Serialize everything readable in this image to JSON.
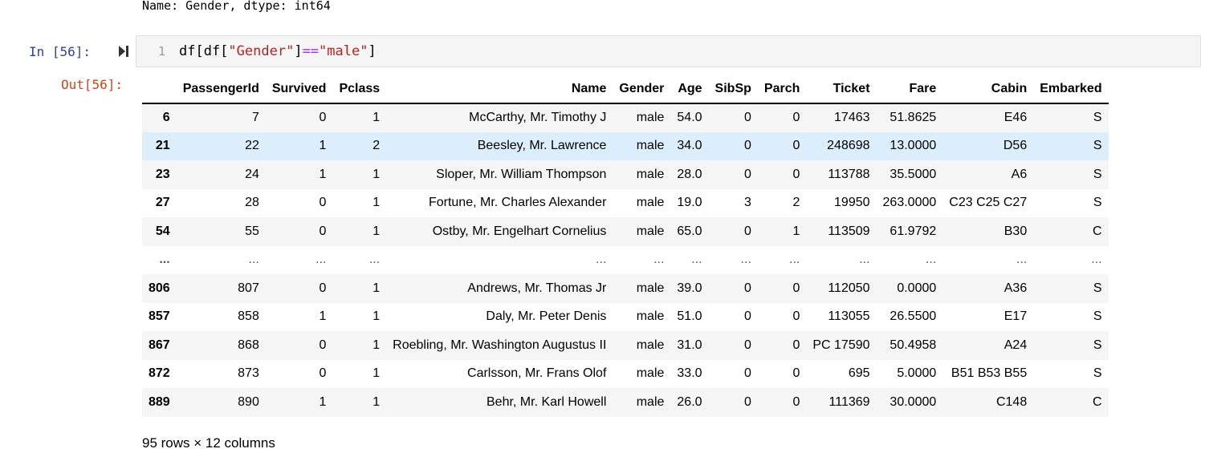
{
  "prev_output": "Name: Gender, dtype: int64",
  "cell": {
    "in_prompt": "In [56]:",
    "out_prompt": "Out[56]:",
    "line_number": "1",
    "code_tokens": [
      {
        "t": "df[df[",
        "c": "plain"
      },
      {
        "t": "\"Gender\"",
        "c": "str"
      },
      {
        "t": "]",
        "c": "plain"
      },
      {
        "t": "==",
        "c": "op"
      },
      {
        "t": "\"male\"",
        "c": "str"
      },
      {
        "t": "]",
        "c": "plain"
      }
    ]
  },
  "table": {
    "columns": [
      "",
      "PassengerId",
      "Survived",
      "Pclass",
      "Name",
      "Gender",
      "Age",
      "SibSp",
      "Parch",
      "Ticket",
      "Fare",
      "Cabin",
      "Embarked"
    ],
    "rows": [
      [
        "6",
        "7",
        "0",
        "1",
        "McCarthy, Mr. Timothy J",
        "male",
        "54.0",
        "0",
        "0",
        "17463",
        "51.8625",
        "E46",
        "S"
      ],
      [
        "21",
        "22",
        "1",
        "2",
        "Beesley, Mr. Lawrence",
        "male",
        "34.0",
        "0",
        "0",
        "248698",
        "13.0000",
        "D56",
        "S"
      ],
      [
        "23",
        "24",
        "1",
        "1",
        "Sloper, Mr. William Thompson",
        "male",
        "28.0",
        "0",
        "0",
        "113788",
        "35.5000",
        "A6",
        "S"
      ],
      [
        "27",
        "28",
        "0",
        "1",
        "Fortune, Mr. Charles Alexander",
        "male",
        "19.0",
        "3",
        "2",
        "19950",
        "263.0000",
        "C23 C25 C27",
        "S"
      ],
      [
        "54",
        "55",
        "0",
        "1",
        "Ostby, Mr. Engelhart Cornelius",
        "male",
        "65.0",
        "0",
        "1",
        "113509",
        "61.9792",
        "B30",
        "C"
      ],
      [
        "...",
        "...",
        "...",
        "...",
        "...",
        "...",
        "...",
        "...",
        "...",
        "...",
        "...",
        "...",
        "..."
      ],
      [
        "806",
        "807",
        "0",
        "1",
        "Andrews, Mr. Thomas Jr",
        "male",
        "39.0",
        "0",
        "0",
        "112050",
        "0.0000",
        "A36",
        "S"
      ],
      [
        "857",
        "858",
        "1",
        "1",
        "Daly, Mr. Peter Denis",
        "male",
        "51.0",
        "0",
        "0",
        "113055",
        "26.5500",
        "E17",
        "S"
      ],
      [
        "867",
        "868",
        "0",
        "1",
        "Roebling, Mr. Washington Augustus II",
        "male",
        "31.0",
        "0",
        "0",
        "PC 17590",
        "50.4958",
        "A24",
        "S"
      ],
      [
        "872",
        "873",
        "0",
        "1",
        "Carlsson, Mr. Frans Olof",
        "male",
        "33.0",
        "0",
        "0",
        "695",
        "5.0000",
        "B51 B53 B55",
        "S"
      ],
      [
        "889",
        "890",
        "1",
        "1",
        "Behr, Mr. Karl Howell",
        "male",
        "26.0",
        "0",
        "0",
        "111369",
        "30.0000",
        "C148",
        "C"
      ]
    ],
    "highlighted_row": 1,
    "summary": "95 rows × 12 columns"
  },
  "icons": {
    "run": "run-cell-icon"
  },
  "colors": {
    "in_prompt": "#303f9f",
    "out_prompt": "#d84315",
    "string": "#ba2121",
    "operator": "#aa22ff",
    "row_highlight": "#dceefb"
  }
}
